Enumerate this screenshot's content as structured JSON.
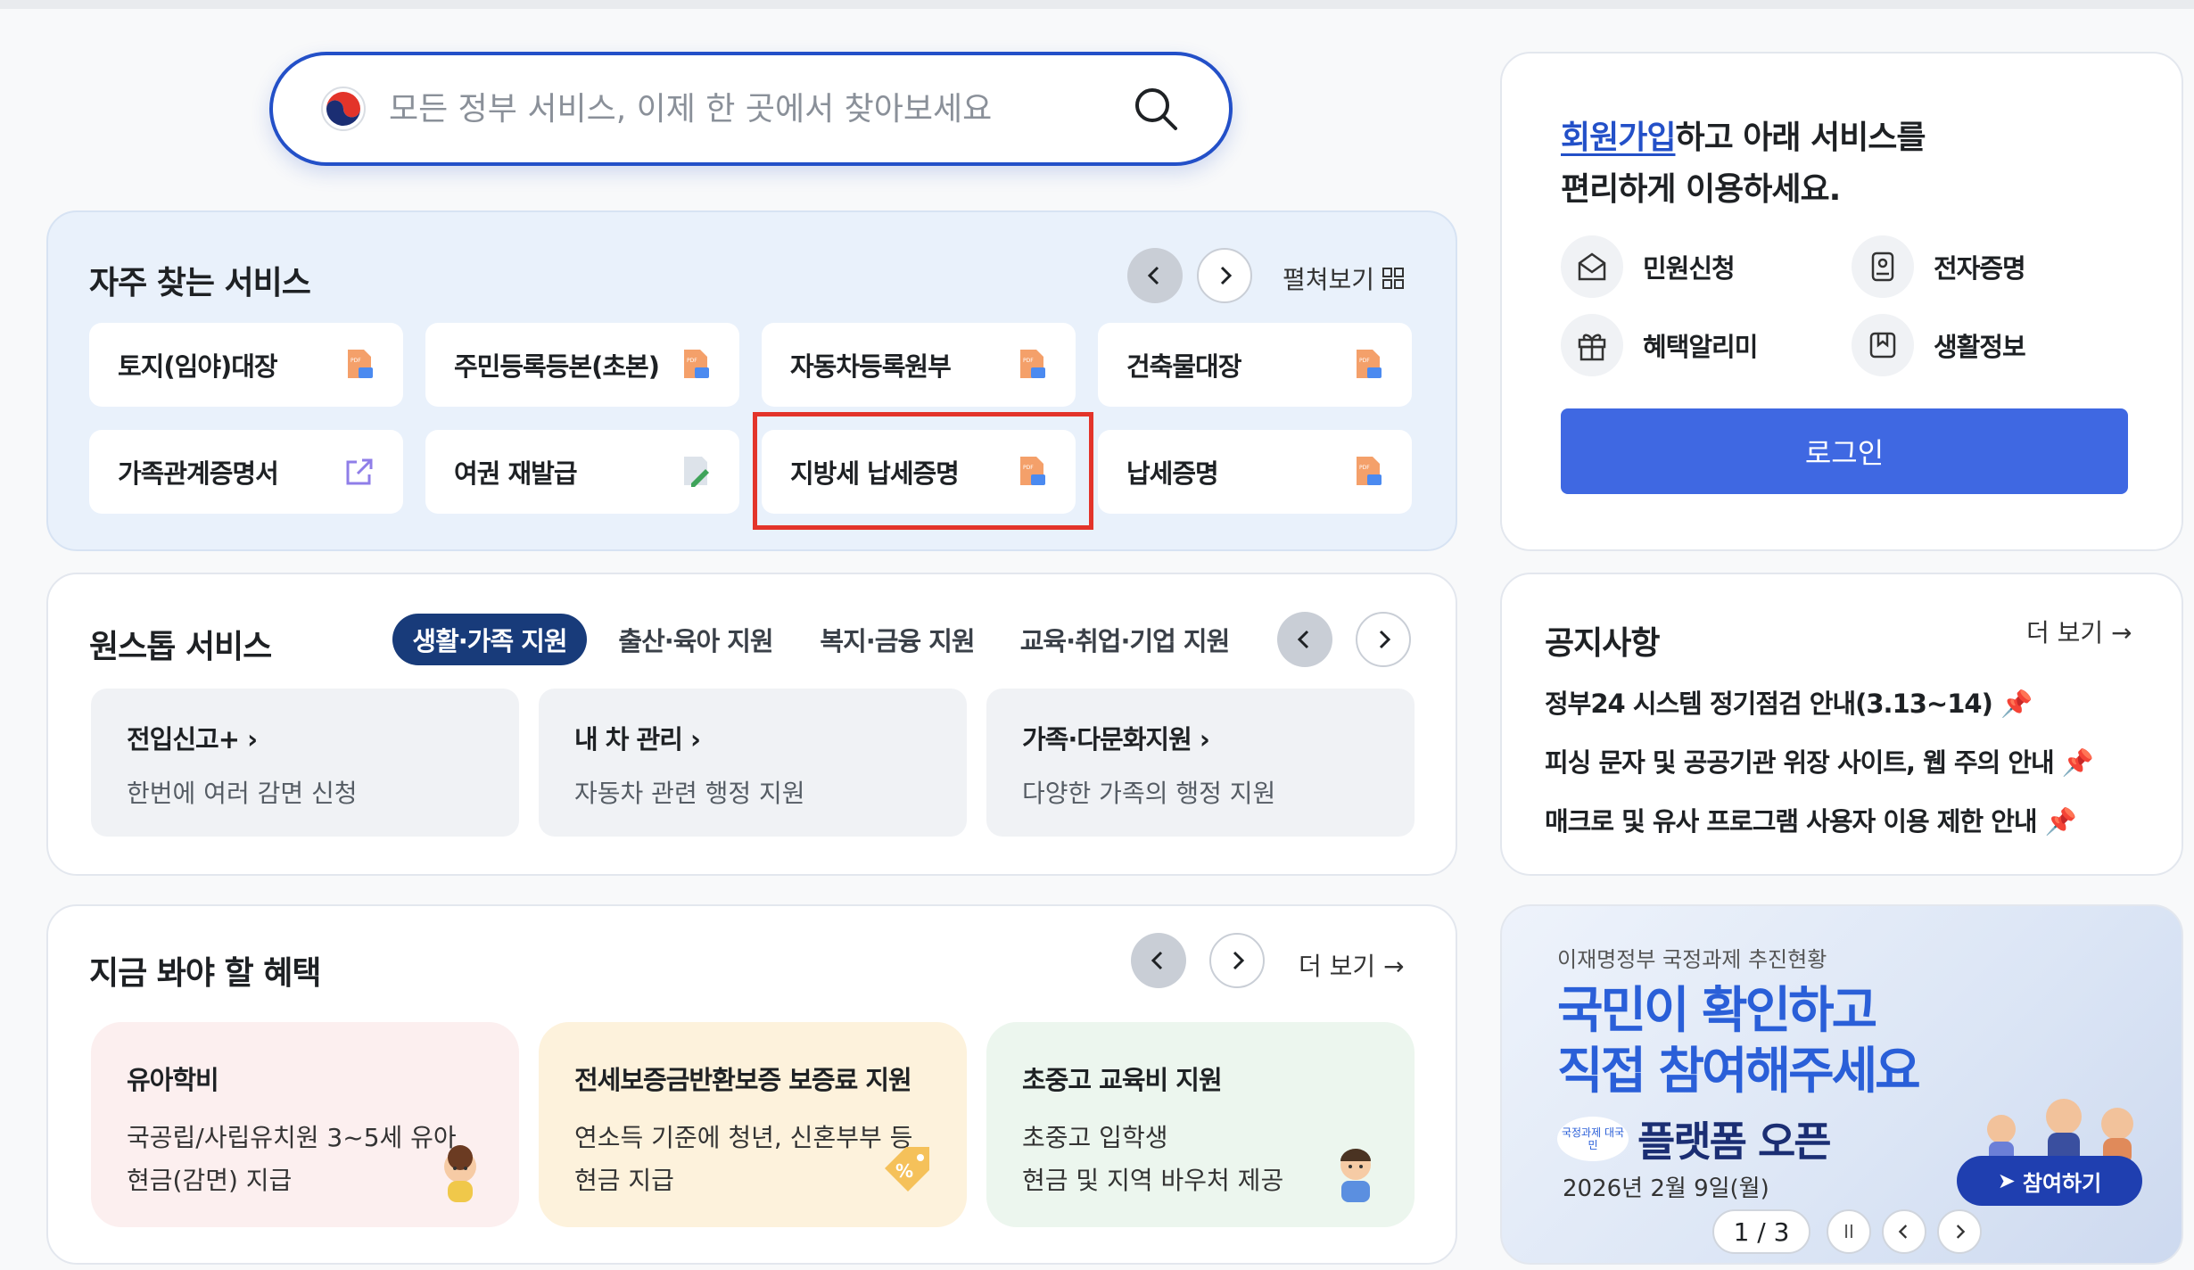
{
  "search": {
    "placeholder": "모든 정부 서비스, 이제 한 곳에서 찾아보세요"
  },
  "frequent": {
    "title": "자주 찾는 서비스",
    "expand_label": "펼쳐보기",
    "items": [
      {
        "label": "토지(임야)대장",
        "icon": "pdf-document-icon"
      },
      {
        "label": "주민등록등본(초본)",
        "icon": "pdf-document-icon"
      },
      {
        "label": "자동차등록원부",
        "icon": "pdf-document-icon"
      },
      {
        "label": "건축물대장",
        "icon": "pdf-document-icon"
      },
      {
        "label": "가족관계증명서",
        "icon": "external-link-icon"
      },
      {
        "label": "여권 재발급",
        "icon": "edit-document-icon"
      },
      {
        "label": "지방세 납세증명",
        "icon": "pdf-document-icon"
      },
      {
        "label": "납세증명",
        "icon": "pdf-document-icon"
      }
    ]
  },
  "onestop": {
    "title": "원스톱 서비스",
    "tabs": [
      "생활·가족 지원",
      "출산·육아 지원",
      "복지·금융 지원",
      "교육·취업·기업 지원"
    ],
    "active_tab": "생활·가족 지원",
    "cards": [
      {
        "title": "전입신고+",
        "desc": "한번에 여러 감면 신청"
      },
      {
        "title": "내 차 관리",
        "desc": "자동차 관련 행정 지원"
      },
      {
        "title": "가족·다문화지원",
        "desc": "다양한 가족의 행정 지원"
      }
    ]
  },
  "benefits": {
    "title": "지금 봐야 할 혜택",
    "more_label": "더 보기",
    "cards": [
      {
        "title": "유아학비",
        "line1": "국공립/사립유치원 3~5세 유아",
        "line2": "현금(감면) 지급",
        "bg": "#fcefef"
      },
      {
        "title": "전세보증금반환보증 보증료 지원",
        "line1": "연소득 기준에 청년, 신혼부부 등",
        "line2": "현금 지급",
        "bg": "#fdf2dc"
      },
      {
        "title": "초중고 교육비 지원",
        "line1": "초중고 입학생",
        "line2": "현금 및 지역 바우처 제공",
        "bg": "#ecf6ee"
      }
    ]
  },
  "login": {
    "signup_link": "회원가입",
    "intro_rest": "하고 아래 서비스를",
    "intro_line2": "편리하게 이용하세요.",
    "services": [
      {
        "label": "민원신청",
        "icon": "mail-inbox-icon"
      },
      {
        "label": "전자증명",
        "icon": "id-card-icon"
      },
      {
        "label": "혜택알리미",
        "icon": "gift-icon"
      },
      {
        "label": "생활정보",
        "icon": "bookmark-icon"
      }
    ],
    "button": "로그인"
  },
  "notice": {
    "title": "공지사항",
    "more_label": "더 보기",
    "items": [
      "정부24 시스템 정기점검 안내(3.13~14)",
      "피싱 문자 및 공공기관 위장 사이트, 웹 주의 안내",
      "매크로 및 유사 프로그램 사용자 이용 제한 안내"
    ]
  },
  "banner": {
    "supertitle": "이재명정부 국정과제 추진현황",
    "headline1": "국민이 확인하고",
    "headline2": "직접 참여해주세요",
    "badge": "국정과제 대국민",
    "platform": "플랫폼 오픈",
    "date": "2026년 2월 9일(월)",
    "cta": "참여하기",
    "pager": "1 / 3",
    "pause_symbol": "II"
  },
  "colors": {
    "primary": "#2350c8",
    "login_button": "#3f68e2",
    "highlight": "#e3342a",
    "active_tab": "#183b7a"
  }
}
